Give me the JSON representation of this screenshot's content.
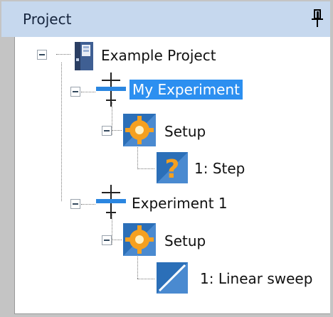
{
  "panel": {
    "title": "Project",
    "pin_icon": "pin-icon"
  },
  "tree": {
    "root": {
      "label": "Example Project",
      "icon": "binder-icon",
      "expanded": true
    },
    "experiments": [
      {
        "label": "My Experiment",
        "selected": true,
        "icon": "experiment-icon",
        "setup": {
          "label": "Setup",
          "icon": "gear-icon"
        },
        "step": {
          "label": "1: Step",
          "icon": "step-icon"
        }
      },
      {
        "label": "Experiment 1",
        "selected": false,
        "icon": "experiment-icon",
        "setup": {
          "label": "Setup",
          "icon": "gear-icon"
        },
        "step": {
          "label": "1: Linear sweep",
          "icon": "linear-sweep-icon"
        }
      }
    ]
  },
  "colors": {
    "selection": "#2c8ff0",
    "titlebar": "#c6d8ee"
  }
}
